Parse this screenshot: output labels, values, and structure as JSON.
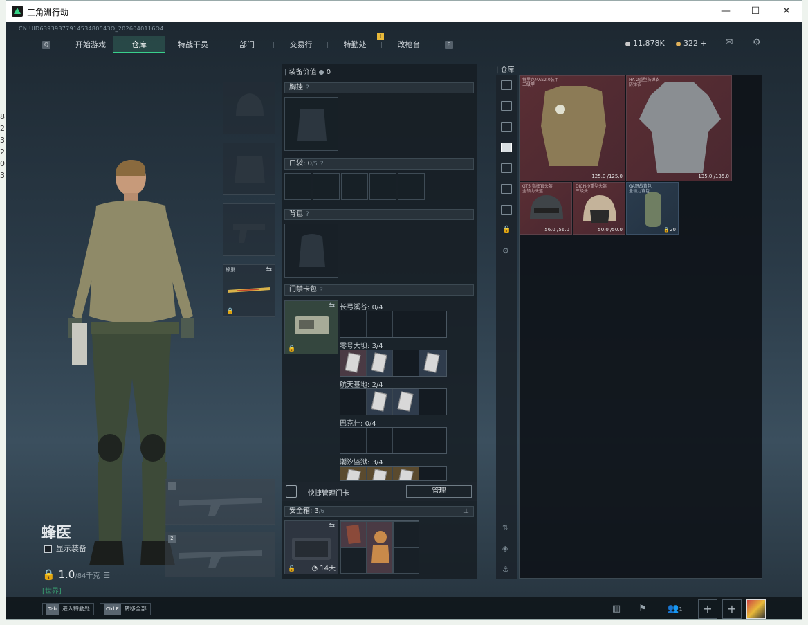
{
  "window": {
    "title": "三角洲行动",
    "minimize": "—",
    "maximize": "☐",
    "close": "✕"
  },
  "left_stub": [
    "8",
    "2",
    "3",
    "2",
    "0",
    "3"
  ],
  "cn_id": "CN:UID6393937791453480543O_2026040116O4",
  "nav": {
    "key_left": "Q",
    "key_right": "E",
    "tabs": [
      "开始游戏",
      "仓库",
      "特战干员",
      "部门",
      "交易行",
      "特勤处",
      "改枪台"
    ],
    "active_tab": "仓库",
    "badge": "!"
  },
  "currency": {
    "silver": "11,878K",
    "gold": "322",
    "plus": "+",
    "silver_color": "#c9c9c9",
    "gold_color": "#e0b15a"
  },
  "character": {
    "name": "蜂医",
    "show_equipment": "显示装备",
    "weight": "1.0",
    "weight_max": "/84千克",
    "chat": "[世界]"
  },
  "melee": {
    "label": "蜂巢"
  },
  "gun_slots": [
    "1",
    "2"
  ],
  "loadout": {
    "equip_value_label": "装备价值",
    "equip_value": "0",
    "chest_rig": "胸挂",
    "pockets": "口袋",
    "pockets_count": "0",
    "pockets_max": "/5",
    "backpack": "背包",
    "keycard_wallet": "门禁卡包",
    "categories": [
      {
        "name": "长弓溪谷",
        "count": "0/4"
      },
      {
        "name": "零号大坝",
        "count": "3/4"
      },
      {
        "name": "航天基地",
        "count": "2/4"
      },
      {
        "name": "巴克什",
        "count": "0/4"
      },
      {
        "name": "潮汐监狱",
        "count": "3/4"
      }
    ],
    "manage_label": "快捷管理门卡",
    "manage_button": "管理",
    "safe_box": "安全箱",
    "safe_count": "3",
    "safe_max": "/6",
    "safe_timer": "14天"
  },
  "warehouse": {
    "title": "仓库",
    "items": [
      {
        "name": "特里克MAS2.0装甲",
        "sub": "三级甲",
        "durability": "125.0 /125.0",
        "rarity": "red"
      },
      {
        "name": "HA-2重型防弹衣",
        "sub": "防弹衣",
        "durability": "135.0 /135.0",
        "rarity": "red"
      },
      {
        "name": "GT5 指挥官头盔",
        "sub": "全领力头盔",
        "durability": "56.0 /56.0",
        "rarity": "red"
      },
      {
        "name": "DICH-9重型头盔",
        "sub": "三级头",
        "durability": "50.0 /50.0",
        "rarity": "red"
      },
      {
        "name": "GA野战背包",
        "sub": "全领力背包",
        "durability": "20",
        "rarity": "blue"
      }
    ]
  },
  "bottom": {
    "hint1_key": "Tab",
    "hint1": "进入特勤处",
    "hint2_key": "Ctrl F",
    "hint2": "转移全部",
    "squad_count": "1",
    "plus": "+"
  }
}
